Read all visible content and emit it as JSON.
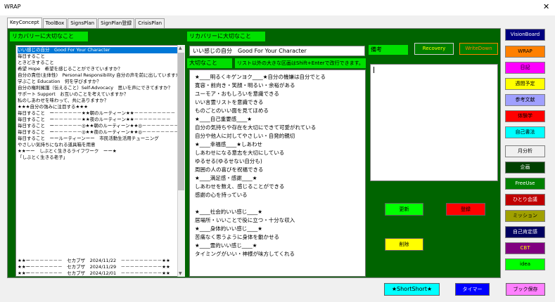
{
  "window": {
    "title": "WRAP",
    "close_glyph": "✕"
  },
  "tabs": [
    "KeyConcept",
    "ToolBox",
    "SignsPlan",
    "SignPlan登録",
    "CrisisPlan"
  ],
  "left": {
    "header": "リカバリーに大切なこと",
    "items": [
      "いい感じの自分　Good For Your Character",
      "毎日すること",
      "ときどきすること",
      "希望 Hope　希望を感じることができていますか？",
      "自分の責任(主体性)　Personal Responsibility 自分の声を前に出していますか？",
      "学ぶこと Education　何を学びますか？",
      "自分の権利擁護（伝えること）Self-Advocacy　思いを声にできてますか？",
      "サポート Support　お互いのことを考えていますか？",
      "私のしあわせを味わって、共にありますか？",
      "★★★自分の強みに注目する★★★",
      "毎日すること　ー－－－－－－★★朝のルーティーン★★－－－－－－－－－",
      "毎日すること　ー－－－－－－★★夜のルーティーン★★－－－－－－－－",
      "毎日すること　ー－－－－－－◎★★朝のルーティーン★★◎－－－－－－－－－",
      "毎日すること　ー－－－－－－◎★★夜のルーティーン★★◎－－－－－－－－",
      "毎日すること　ーールーティーンーー　市民活動生活用チューニング",
      "やさしい気持ちになれる道具箱を用意",
      "★★ーー　しぶとく生きるライフワーク　ーー★",
      "「しぶとく生きる老子」"
    ],
    "bottom_items": [
      "★★ー－－－－－－－　セカブザ　2024/11/22　－－－－－－－－－★★",
      "★★ー－－－－－－－　セカブザ　2024/11/29　－－－－－－－－－★★",
      "★★ー－－－－－－－　セカブザ　2024/12/01　－－－－－－－－－★★"
    ]
  },
  "middle": {
    "header": "リカバリーに大切なこと",
    "selected_text": "いい感じの自分　Good For Your Character",
    "label": "大切なこと",
    "hint": "リスト以外の大きな区画はShift+Enterで改行できます。",
    "content": [
      "★____明るくキゲンヨク____★自分の機嫌は自分でとる",
      "寛容・前向き・笑顔・明るい・余裕がある",
      "ユーモア・おもしろいを意識できる",
      "いい言霊リストを意識できる",
      "ものごとのいい面を見てほめる",
      "★____自己重要感____★",
      "自分の気持ちや存在を大切にできて可愛がれている",
      "自分や他人に対してやさしい・自発的親切",
      "★____幸福感____★しあわせ",
      "しあわせになる意志を大切にしている",
      "ゆるせる(ゆるせない自分も)",
      "周囲の人の喜びを祝福できる",
      "★____満足感・感謝____★",
      "しあわせを数え、感じることができる",
      "感謝の心を持っている",
      "",
      "★____社会的いい感じ____★",
      "居場所・いいことで役に立つ・十分な収入",
      "★____身体的いい感じ____★",
      "苦痛なく思うように身体を動かせる",
      "★____霊的いい感じ____★",
      "タイミングがいい・神様が味方してくれる"
    ]
  },
  "right": {
    "memo_label": "備考",
    "memo_value": "",
    "recovery_button": "Recovery",
    "writedown_button": "WriteDown",
    "update_button": "更新",
    "register_button": "登録",
    "delete_button": "削除"
  },
  "bottom": {
    "shortshort_button": "★ShortShort★",
    "timer_button": "タイマー",
    "save_button": "ブック保存"
  },
  "sidebar": [
    {
      "label": "VisionBoard",
      "bg": "#000080",
      "fg": "#ffffff"
    },
    {
      "label": "WRAP",
      "bg": "#ff8000",
      "fg": "#000000"
    },
    {
      "label": "日記",
      "bg": "#ff00ff",
      "fg": "#000000"
    },
    {
      "label": "週間予定",
      "bg": "#ffff00",
      "fg": "#000000"
    },
    {
      "label": "参考文献",
      "bg": "#a0a0ff",
      "fg": "#000000"
    },
    {
      "label": "体験学",
      "bg": "#ff0000",
      "fg": "#000000"
    },
    {
      "label": "自己書法",
      "bg": "#00ffff",
      "fg": "#000000"
    },
    {
      "label": "月分析",
      "bg": "#f0f0f0",
      "fg": "#000000"
    },
    {
      "label": "企画",
      "bg": "#004000",
      "fg": "#ffffff"
    },
    {
      "label": "FreeUse",
      "bg": "#008000",
      "fg": "#ffffff"
    },
    {
      "label": "ひとり会議",
      "bg": "#c00000",
      "fg": "#ffffff"
    },
    {
      "label": "ミッション",
      "bg": "#a0a000",
      "fg": "#000000"
    },
    {
      "label": "自己肯定感",
      "bg": "#000060",
      "fg": "#ffffff"
    },
    {
      "label": "CBT",
      "bg": "#800080",
      "fg": "#ffff00"
    },
    {
      "label": "idea",
      "bg": "#00ff00",
      "fg": "#000000"
    }
  ],
  "colors": {
    "panel": "#006400",
    "label_green": "#00e000",
    "selection": "#0078d7"
  }
}
